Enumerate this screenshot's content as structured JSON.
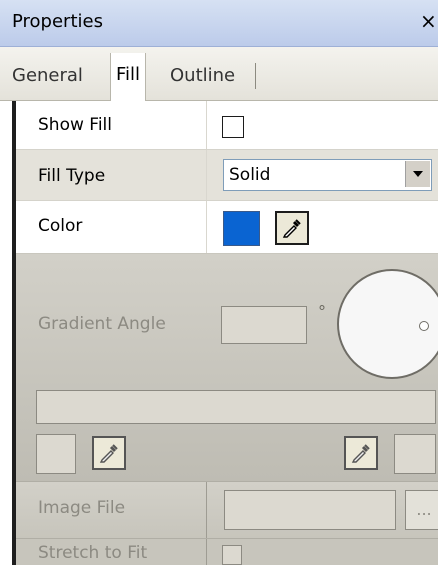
{
  "window": {
    "title": "Properties",
    "close_glyph": "×"
  },
  "tabs": [
    {
      "label": "General",
      "selected": false
    },
    {
      "label": "Fill",
      "selected": true
    },
    {
      "label": "Outline",
      "selected": false
    }
  ],
  "fill": {
    "show_fill": {
      "label": "Show Fill",
      "checked": false
    },
    "fill_type": {
      "label": "Fill Type",
      "value": "Solid"
    },
    "color": {
      "label": "Color",
      "value_hex": "#0A64D2",
      "picker_icon": "eyedropper-icon"
    }
  },
  "gradient": {
    "angle_label": "Gradient Angle",
    "angle_value": "",
    "degree_symbol": "°",
    "enabled": false,
    "picker_icon": "eyedropper-icon"
  },
  "image": {
    "file_label": "Image File",
    "file_value": "",
    "browse_label": "...",
    "stretch_label": "Stretch to Fit",
    "stretch_checked": false,
    "enabled": false
  },
  "colors": {
    "titlebar": "#C9D6EF",
    "selected_color": "#0A64D2",
    "disabled_text": "#8C8A82"
  }
}
